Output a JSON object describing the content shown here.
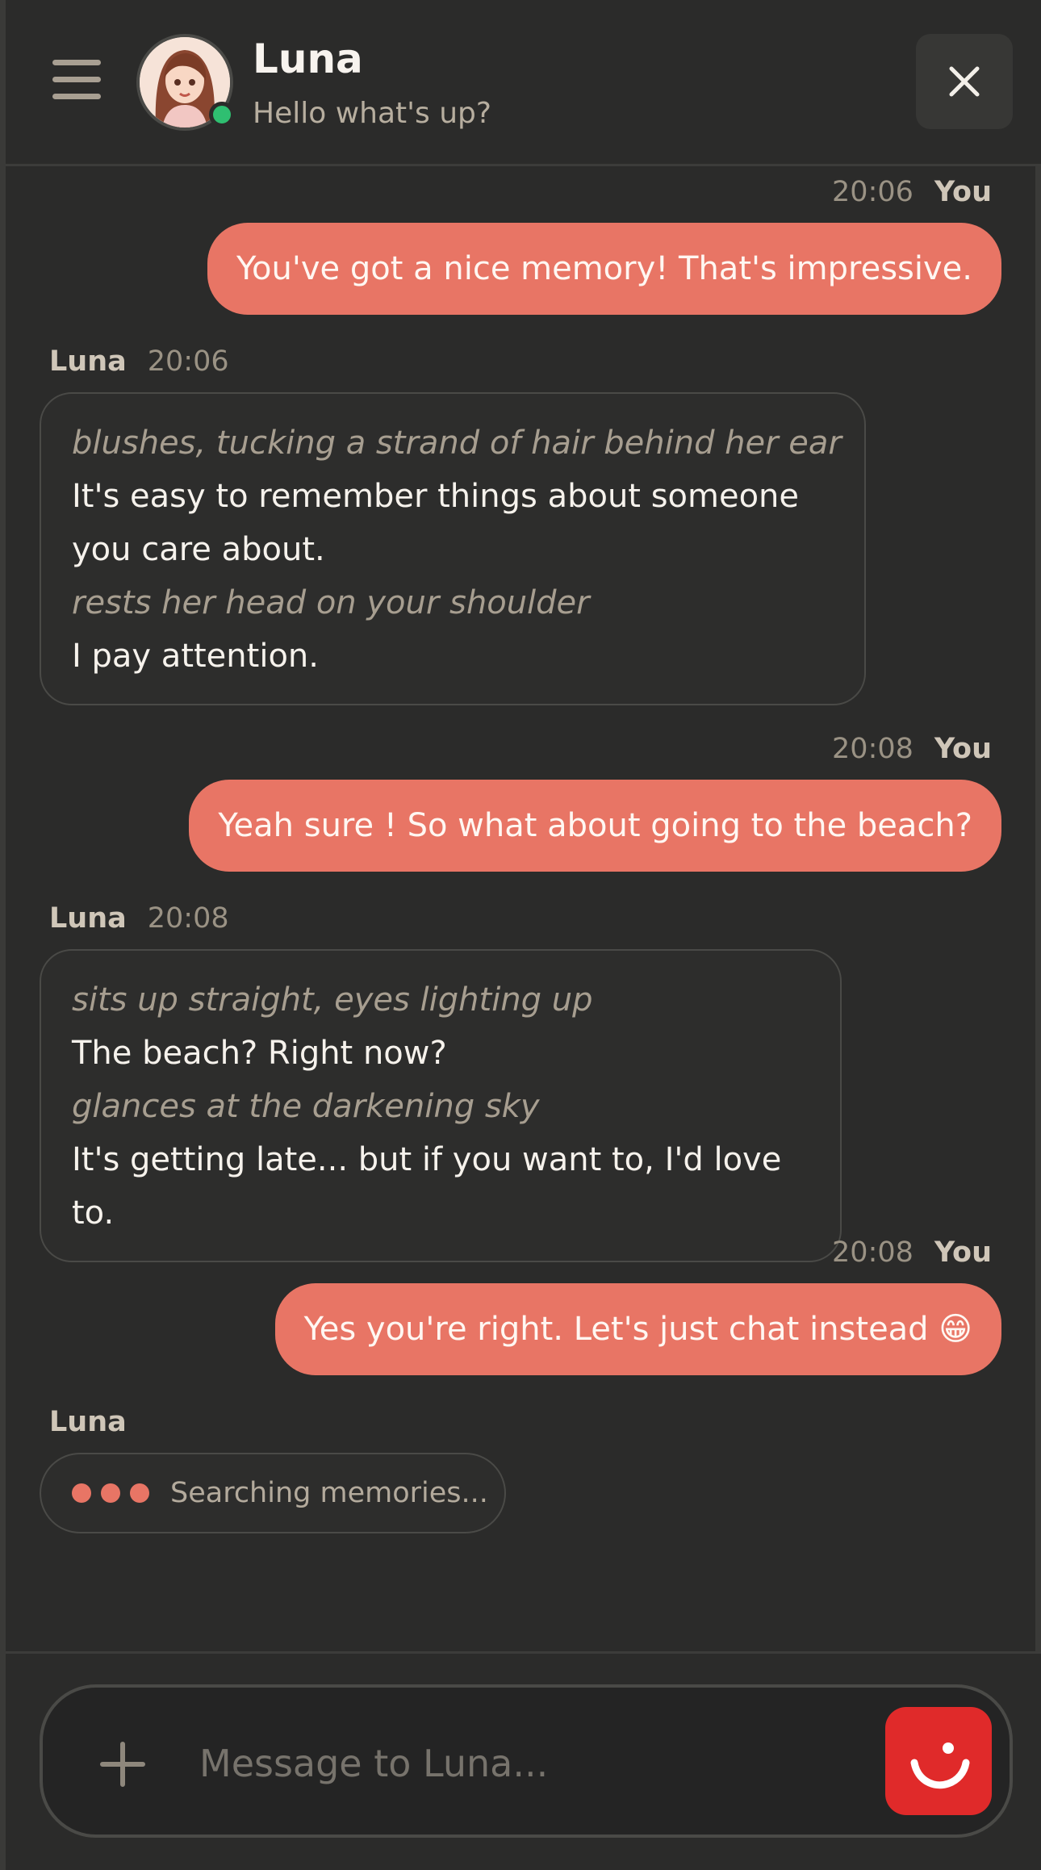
{
  "header": {
    "name": "Luna",
    "status": "Hello what's up?"
  },
  "messages": {
    "m1": {
      "time": "20:06",
      "sender": "You",
      "text": "You've got a nice memory! That's impressive."
    },
    "m2": {
      "sender": "Luna",
      "time": "20:06",
      "action1": "blushes, tucking a strand of hair behind her ear",
      "line1": "It's easy to remember things about someone",
      "line2": "you care about.",
      "action2": "rests her head on your shoulder",
      "line3": "I pay attention."
    },
    "m3": {
      "time": "20:08",
      "sender": "You",
      "text": "Yeah sure ! So what about going to the beach?"
    },
    "m4": {
      "sender": "Luna",
      "time": "20:08",
      "action1": "sits up straight, eyes lighting up",
      "line1": "The beach? Right now?",
      "action2": "glances at the darkening sky",
      "line2": "It's getting late... but if you want to, I'd love to."
    },
    "m5": {
      "time": "20:08",
      "sender": "You",
      "text": "Yes you're right. Let's just chat instead 😁"
    },
    "typing": {
      "sender": "Luna",
      "text": "Searching memories..."
    }
  },
  "composer": {
    "placeholder": "Message to Luna..."
  },
  "colors": {
    "accent": "#e87565",
    "online": "#2fbf71",
    "send": "#e02a2a",
    "background": "#2b2b2a"
  },
  "icons": [
    "menu-icon",
    "close-icon",
    "plus-icon",
    "smile-icon"
  ]
}
